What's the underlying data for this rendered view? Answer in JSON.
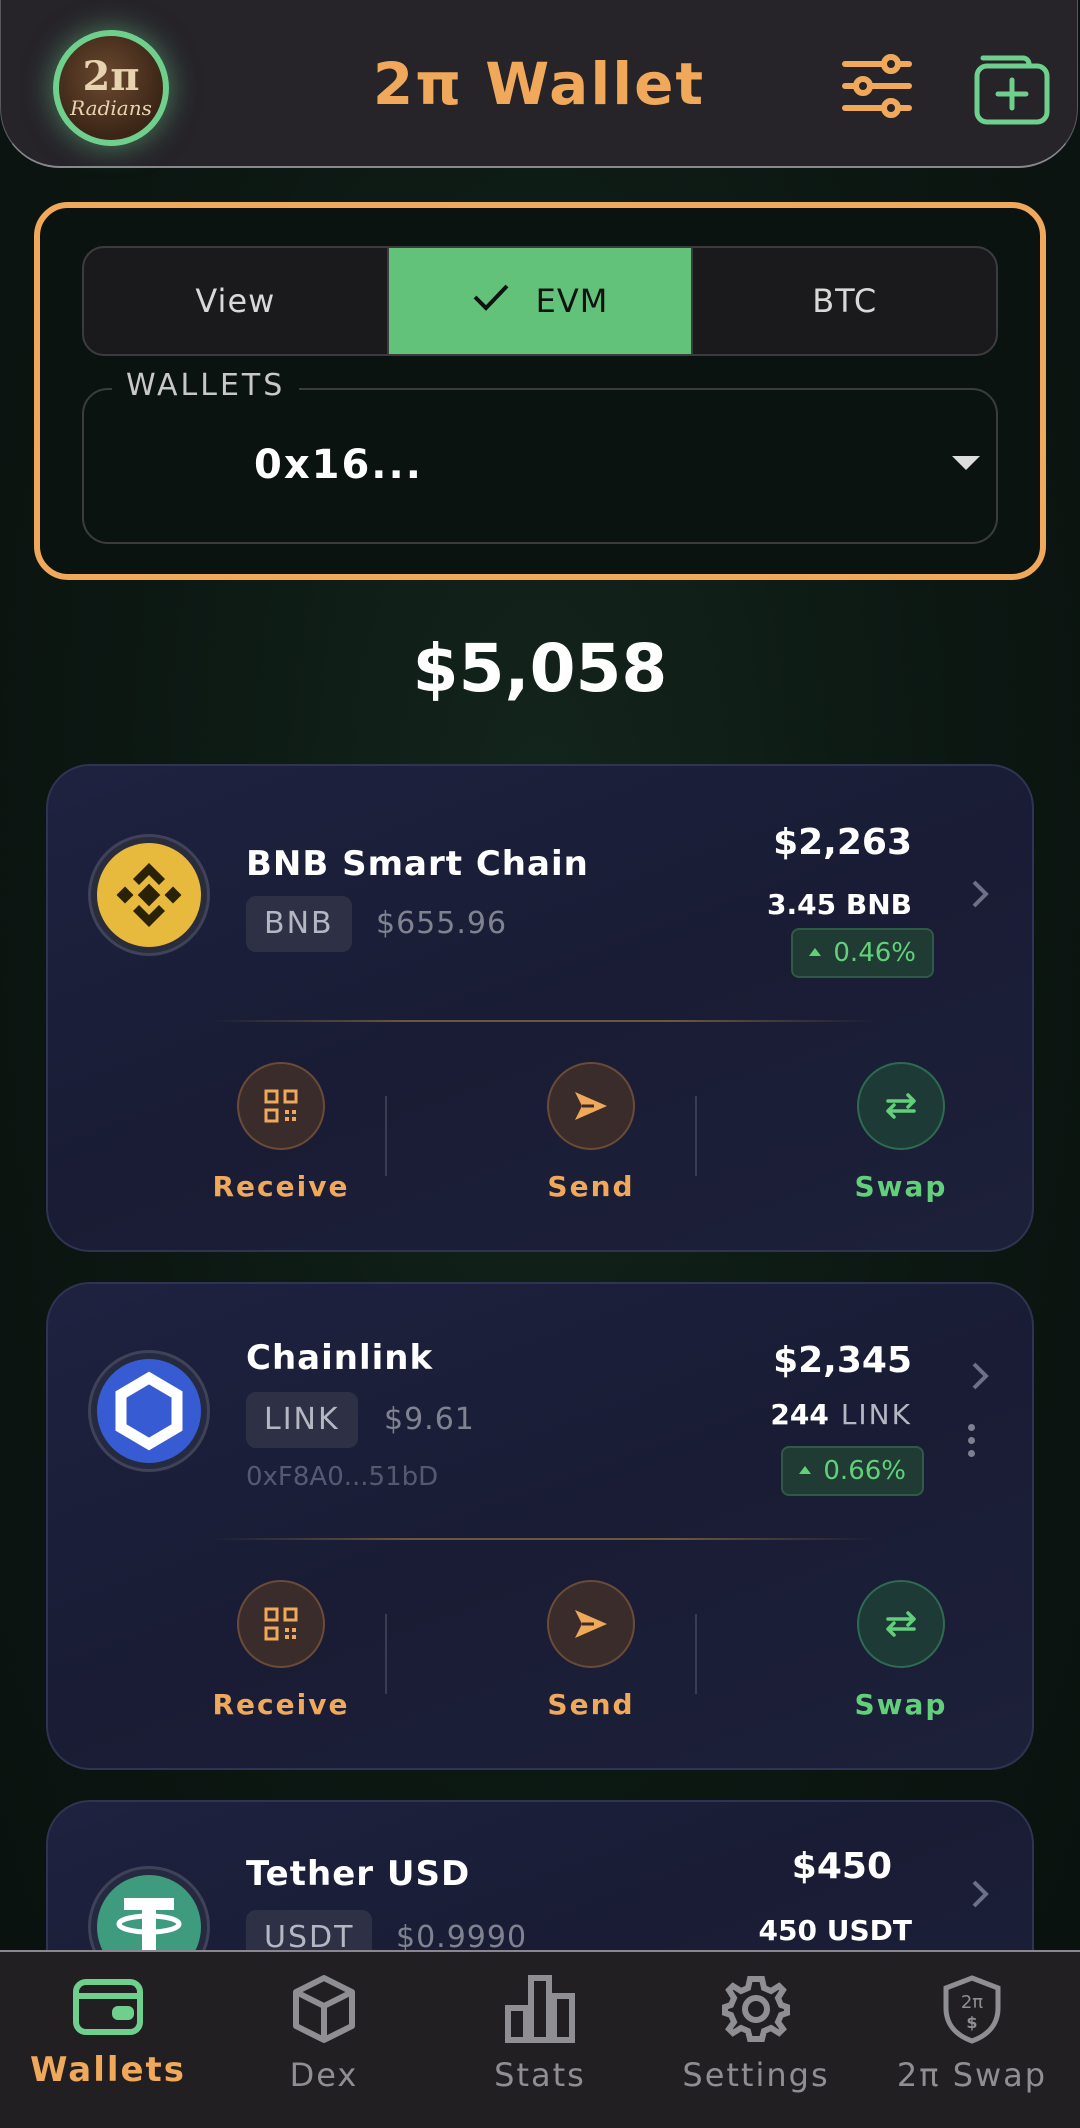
{
  "header": {
    "logo_text_top": "2π",
    "logo_text_bottom": "Radians",
    "title": "2π Wallet",
    "filter_icon": "sliders-icon",
    "add_icon": "add-wallet-icon"
  },
  "selector": {
    "tabs": [
      {
        "label": "View",
        "active": false
      },
      {
        "label": "EVM",
        "active": true
      },
      {
        "label": "BTC",
        "active": false
      }
    ],
    "wallets_label": "WALLETS",
    "wallet_value": "0x16..."
  },
  "total_balance": "$5,058",
  "assets": [
    {
      "name": "BNB Smart Chain",
      "symbol": "BNB",
      "price": "$655.96",
      "address": "",
      "value": "$2,263",
      "amount": "3.45 BNB",
      "amount_number": "",
      "amount_unit": "",
      "change": "0.46%",
      "icon": "bnb-icon",
      "actions": [
        "Receive",
        "Send",
        "Swap"
      ]
    },
    {
      "name": "Chainlink",
      "symbol": "LINK",
      "price": "$9.61",
      "address": "0xF8A0...51bD",
      "value": "$2,345",
      "amount_number": "244",
      "amount_unit": "LINK",
      "change": "0.66%",
      "icon": "chainlink-icon",
      "actions": [
        "Receive",
        "Send",
        "Swap"
      ]
    },
    {
      "name": "Tether USD",
      "symbol": "USDT",
      "price": "$0.9990",
      "value": "$450",
      "amount": "450 USDT",
      "icon": "tether-icon"
    }
  ],
  "nav": [
    {
      "label": "Wallets",
      "icon": "wallet-icon",
      "active": true
    },
    {
      "label": "Dex",
      "icon": "cube-icon",
      "active": false
    },
    {
      "label": "Stats",
      "icon": "bar-chart-icon",
      "active": false
    },
    {
      "label": "Settings",
      "icon": "gear-icon",
      "active": false
    },
    {
      "label": "2π Swap",
      "icon": "shield-swap-icon",
      "active": false
    }
  ],
  "colors": {
    "accent_orange": "#f0a85a",
    "accent_green": "#62c279",
    "card_bg": "#1e2240"
  }
}
